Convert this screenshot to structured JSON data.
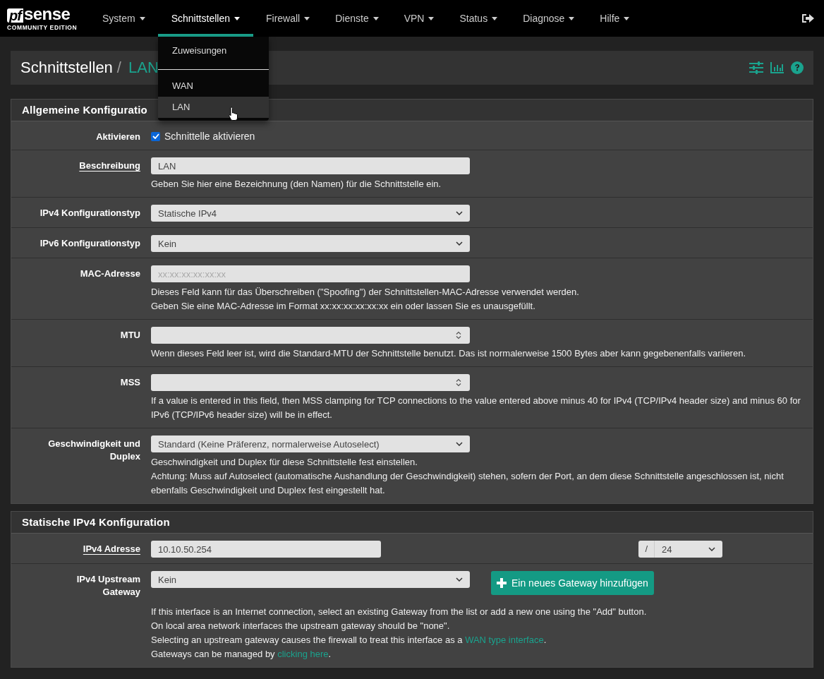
{
  "logo": {
    "mark": "pf",
    "name": "sense",
    "edition": "COMMUNITY EDITION"
  },
  "nav": {
    "items": [
      {
        "label": "System",
        "selected": false
      },
      {
        "label": "Schnittstellen",
        "selected": true
      },
      {
        "label": "Firewall",
        "selected": false
      },
      {
        "label": "Dienste",
        "selected": false
      },
      {
        "label": "VPN",
        "selected": false
      },
      {
        "label": "Status",
        "selected": false
      },
      {
        "label": "Diagnose",
        "selected": false
      },
      {
        "label": "Hilfe",
        "selected": false
      }
    ],
    "dropdown": [
      {
        "kind": "item",
        "label": "Zuweisungen",
        "selected": false
      },
      {
        "kind": "divider"
      },
      {
        "kind": "item",
        "label": "WAN",
        "selected": false
      },
      {
        "kind": "item",
        "label": "LAN",
        "selected": true
      }
    ]
  },
  "page_header": {
    "section": "Schnittstellen",
    "separator": "/",
    "current": "LAN"
  },
  "panels": [
    {
      "title": "Allgemeine Konfiguratio",
      "rows": [
        {
          "kind": "checkbox",
          "label": "Aktivieren",
          "underlined": false,
          "checked": true,
          "text": "Schnittelle aktivieren"
        },
        {
          "kind": "text",
          "label": "Beschreibung",
          "underlined": true,
          "value": "LAN",
          "help": [
            [
              {
                "kind": "text",
                "text": "Geben Sie hier eine Bezeichnung (den Namen) für die Schnittstelle ein."
              }
            ]
          ]
        },
        {
          "kind": "select",
          "label": "IPv4 Konfigurationstyp",
          "underlined": false,
          "value": "Statische IPv4"
        },
        {
          "kind": "select",
          "label": "IPv6 Konfigurationstyp",
          "underlined": false,
          "value": "Kein"
        },
        {
          "kind": "text",
          "label": "MAC-Adresse",
          "underlined": false,
          "placeholder": "xx:xx:xx:xx:xx:xx",
          "help": [
            [
              {
                "kind": "text",
                "text": "Dieses Feld kann für das Überschreiben (\"Spoofing\") der Schnittstellen-MAC-Adresse verwendet werden."
              }
            ],
            [
              {
                "kind": "text",
                "text": "Geben Sie eine MAC-Adresse im Format xx:xx:xx:xx:xx:xx ein oder lassen Sie es unausgefüllt."
              }
            ]
          ]
        },
        {
          "kind": "number",
          "label": "MTU",
          "underlined": false,
          "help": [
            [
              {
                "kind": "text",
                "text": "Wenn dieses Feld leer ist, wird die Standard-MTU der Schnittstelle benutzt. Das ist normalerweise 1500 Bytes aber kann gegebenenfalls variieren."
              }
            ]
          ]
        },
        {
          "kind": "number",
          "label": "MSS",
          "underlined": false,
          "help": [
            [
              {
                "kind": "text",
                "text": "If a value is entered in this field, then MSS clamping for TCP connections to the value entered above minus 40 for IPv4 (TCP/IPv4 header size) and minus 60 for IPv6 (TCP/IPv6 header size) will be in effect."
              }
            ]
          ]
        },
        {
          "kind": "select",
          "label": "Geschwindigkeit und Duplex",
          "underlined": false,
          "value": "Standard (Keine Präferenz, normalerweise Autoselect)",
          "help": [
            [
              {
                "kind": "text",
                "text": "Geschwindigkeit und Duplex für diese Schnittstelle fest einstellen."
              }
            ],
            [
              {
                "kind": "text",
                "text": "Achtung: Muss auf Autoselect (automatische Aushandlung der Geschwindigkeit) stehen, sofern der Port, an dem diese Schnittstelle angeschlossen ist, nicht ebenfalls Geschwindigkeit und Duplex fest eingestellt hat."
              }
            ]
          ]
        }
      ]
    },
    {
      "title": "Statische IPv4 Konfiguration",
      "rows": [
        {
          "kind": "ipaddr",
          "label": "IPv4 Adresse",
          "underlined": true,
          "value": "10.10.50.254",
          "slash": "/",
          "cidr": "24"
        },
        {
          "kind": "gateway",
          "label": "IPv4 Upstream Gateway",
          "underlined": false,
          "value": "Kein",
          "button": "Ein neues Gateway hinzufügen",
          "help": [
            [
              {
                "kind": "text",
                "text": "If this interface is an Internet connection, select an existing Gateway from the list or add a new one using the \"Add\" button."
              }
            ],
            [
              {
                "kind": "text",
                "text": "On local area network interfaces the upstream gateway should be \"none\"."
              }
            ],
            [
              {
                "kind": "text",
                "text": "Selecting an upstream gateway causes the firewall to treat this interface as a "
              },
              {
                "kind": "link",
                "text": "WAN type interface"
              },
              {
                "kind": "text",
                "text": "."
              }
            ],
            [
              {
                "kind": "text",
                "text": "Gateways can be managed by "
              },
              {
                "kind": "link",
                "text": "clicking here"
              },
              {
                "kind": "text",
                "text": "."
              }
            ]
          ]
        }
      ]
    }
  ]
}
